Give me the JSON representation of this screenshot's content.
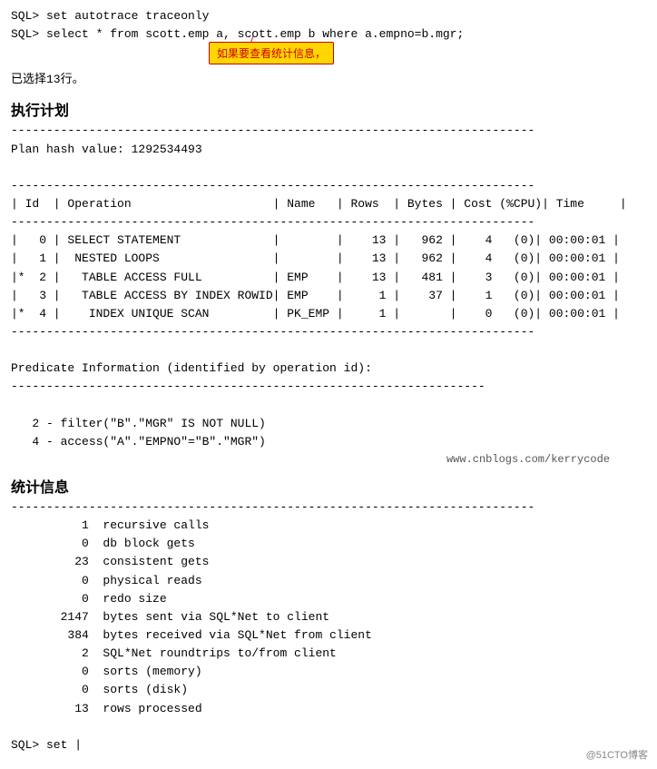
{
  "terminal": {
    "lines": {
      "sql_set": "SQL> set autotrace traceonly",
      "sql_select": "SQL> select * from scott.emp a, scott.emp b where a.empno=b.mgr;",
      "rows_selected": "已选择13行。",
      "annotation_text": "如果要查看统计信息，",
      "exec_plan_title": "执行计划",
      "divider1": "--------------------------------------------------------------------------",
      "plan_hash": "Plan hash value: 1292534493",
      "divider2": "--------------------------------------------------------------------------",
      "table_header": "| Id  | Operation                    | Name   | Rows  | Bytes | Cost (%CPU)| Time     |",
      "divider3": "--------------------------------------------------------------------------",
      "row0": "|   0 | SELECT STATEMENT             |        |    13 |   962 |    4   (0)| 00:00:01 |",
      "row1": "|   1 |  NESTED LOOPS                |        |    13 |   962 |    4   (0)| 00:00:01 |",
      "row2": "|*  2 |   TABLE ACCESS FULL          | EMP    |    13 |   481 |    3   (0)| 00:00:01 |",
      "row3": "|   3 |   TABLE ACCESS BY INDEX ROWID| EMP    |     1 |    37 |    1   (0)| 00:00:01 |",
      "row4": "|*  4 |    INDEX UNIQUE SCAN         | PK_EMP |     1 |       |    0   (0)| 00:00:01 |",
      "divider4": "--------------------------------------------------------------------------",
      "predicate_title": "Predicate Information (identified by operation id):",
      "divider5": "-------------------------------------------------------------------",
      "pred2": "   2 - filter(\"B\".\"MGR\" IS NOT NULL)",
      "pred4": "   4 - access(\"A\".\"EMPNO\"=\"B\".\"MGR\")",
      "watermark": "www.cnblogs.com/kerrycode",
      "stats_title": "统计信息",
      "divider6": "--------------------------------------------------------------------------",
      "stat1": "          1  recursive calls",
      "stat2": "          0  db block gets",
      "stat3": "         23  consistent gets",
      "stat4": "          0  physical reads",
      "stat5": "          0  redo size",
      "stat6": "       2147  bytes sent via SQL*Net to client",
      "stat7": "        384  bytes received via SQL*Net from client",
      "stat8": "          2  SQL*Net roundtrips to/from client",
      "stat9": "          0  sorts (memory)",
      "stat10": "          0  sorts (disk)",
      "stat11": "         13  rows processed",
      "sql_set2": "SQL> set |",
      "footer_badge": "@51CTO博客"
    }
  }
}
